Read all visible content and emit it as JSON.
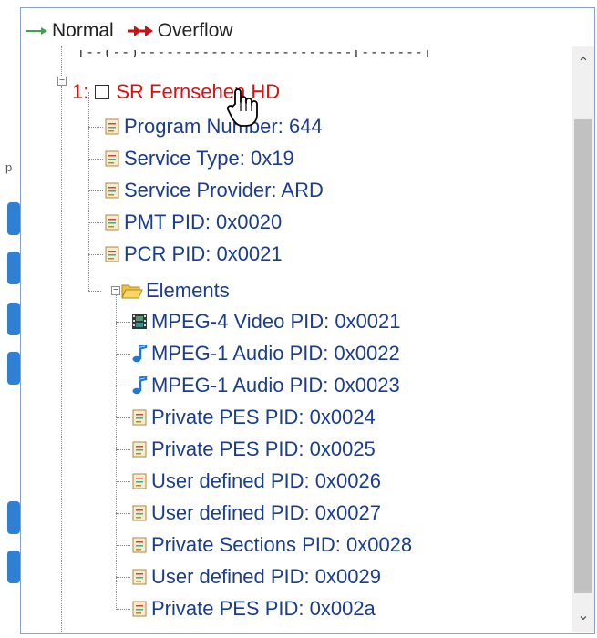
{
  "legend": {
    "normal_label": "Normal",
    "overflow_label": "Overflow"
  },
  "service": {
    "index_label": "1:",
    "name": "SR Fernsehen HD"
  },
  "properties": [
    {
      "label": "Program Number: 644"
    },
    {
      "label": "Service Type: 0x19"
    },
    {
      "label": "Service Provider: ARD"
    },
    {
      "label": "PMT PID: 0x0020"
    },
    {
      "label": "PCR PID: 0x0021"
    }
  ],
  "elements_label": "Elements",
  "elements": [
    {
      "label": "MPEG-4 Video PID: 0x0021",
      "icon": "video-icon"
    },
    {
      "label": "MPEG-1 Audio PID: 0x0022",
      "icon": "audio-icon"
    },
    {
      "label": "MPEG-1 Audio PID: 0x0023",
      "icon": "audio-icon"
    },
    {
      "label": "Private PES PID: 0x0024",
      "icon": "document-icon"
    },
    {
      "label": "Private PES PID: 0x0025",
      "icon": "document-icon"
    },
    {
      "label": "User defined PID: 0x0026",
      "icon": "document-icon"
    },
    {
      "label": "User defined PID: 0x0027",
      "icon": "document-icon"
    },
    {
      "label": "Private Sections PID: 0x0028",
      "icon": "document-icon"
    },
    {
      "label": "User defined PID: 0x0029",
      "icon": "document-icon"
    },
    {
      "label": "Private PES PID: 0x002a",
      "icon": "document-icon"
    }
  ],
  "colors": {
    "service_name": "#e01010",
    "tree_text": "#1a3d8f",
    "normal_arrow": "#3aa64a",
    "overflow_arrow": "#cc1111"
  }
}
